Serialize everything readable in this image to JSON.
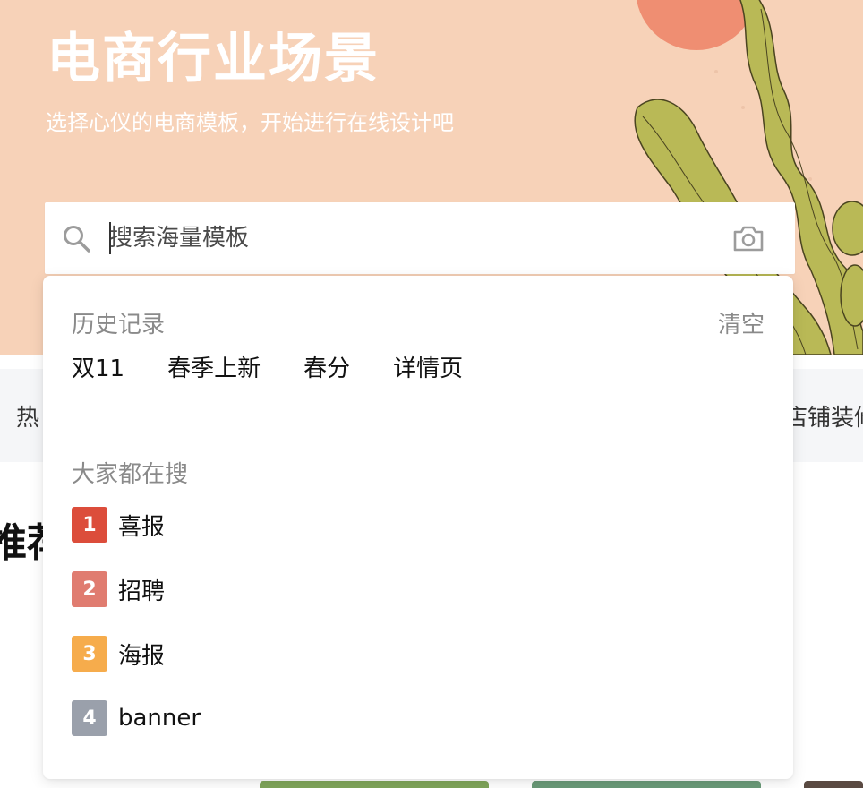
{
  "hero": {
    "title": "电商行业场景",
    "subtitle": "选择心仪的电商模板，开始进行在线设计吧"
  },
  "search": {
    "placeholder": "搜索海量模板",
    "value": "",
    "icons": {
      "left": "search-icon",
      "right": "camera-icon"
    }
  },
  "category_bar": {
    "left_partial": "热",
    "right_partial": "店铺装修"
  },
  "section_partial": "推荐",
  "dropdown": {
    "history_title": "历史记录",
    "clear_label": "清空",
    "history": [
      "双11",
      "春季上新",
      "春分",
      "详情页"
    ],
    "popular_title": "大家都在搜",
    "popular": [
      {
        "rank": "1",
        "label": "喜报",
        "color": "#dc4d3b"
      },
      {
        "rank": "2",
        "label": "招聘",
        "color": "#e07c70"
      },
      {
        "rank": "3",
        "label": "海报",
        "color": "#f6ac4c"
      },
      {
        "rank": "4",
        "label": "banner",
        "color": "#9aa0ab"
      }
    ]
  },
  "colors": {
    "hero_bg": "#f7d2b8",
    "sun": "#ef8e72",
    "leaf": "#b9b956"
  }
}
